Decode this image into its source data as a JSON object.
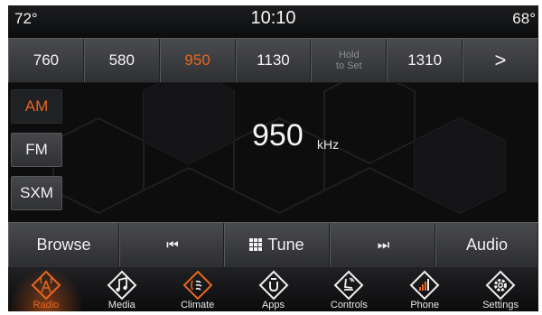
{
  "status": {
    "temp_left": "72°",
    "time": "10:10",
    "temp_right": "68°"
  },
  "presets": [
    {
      "label": "760",
      "active": false
    },
    {
      "label": "580",
      "active": false
    },
    {
      "label": "950",
      "active": true
    },
    {
      "label": "1130",
      "active": false
    },
    {
      "label_line1": "Hold",
      "label_line2": "to Set",
      "hold": true
    },
    {
      "label": "1310",
      "active": false
    },
    {
      "label": ">",
      "next": true
    }
  ],
  "bands": {
    "am": "AM",
    "fm": "FM",
    "sxm": "SXM",
    "active": "AM"
  },
  "tuner": {
    "frequency": "950",
    "unit": "kHz"
  },
  "controls": {
    "browse": "Browse",
    "prev": "⏮",
    "tune": "Tune",
    "next": "⏭",
    "audio": "Audio"
  },
  "nav": {
    "radio": "Radio",
    "media": "Media",
    "climate": "Climate",
    "apps": "Apps",
    "controls": "Controls",
    "phone": "Phone",
    "settings": "Settings",
    "active": "Radio"
  },
  "colors": {
    "accent": "#e8661f",
    "background": "#0d0d0e",
    "button": "#3c3d40"
  }
}
